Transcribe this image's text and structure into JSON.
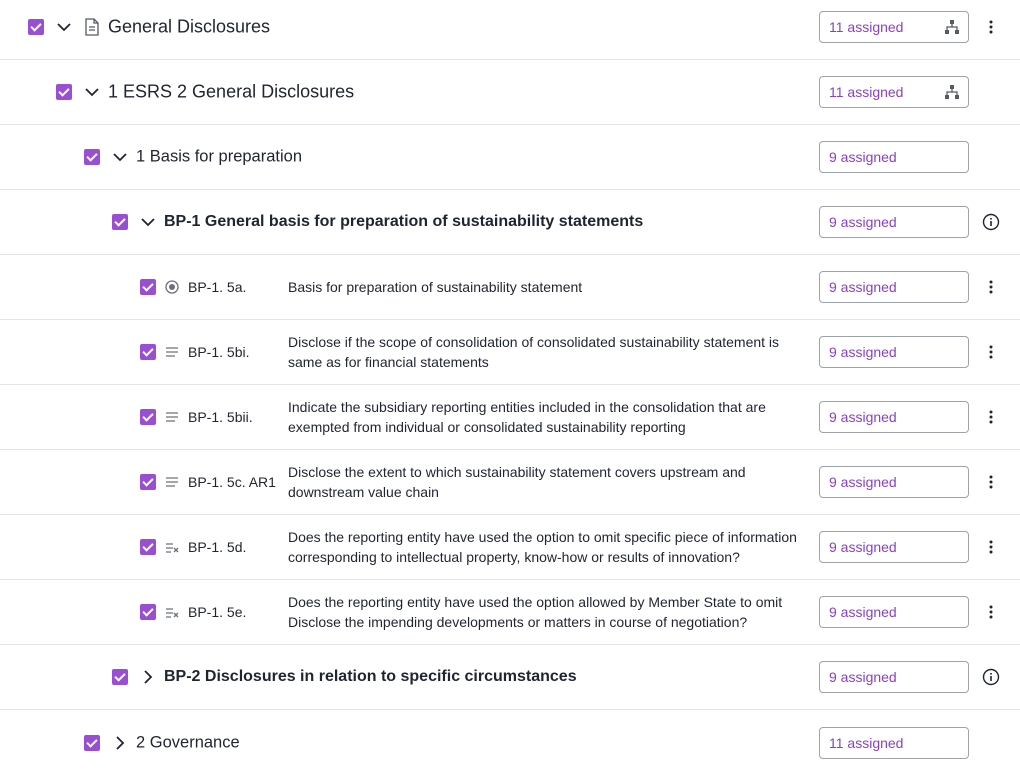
{
  "rows": [
    {
      "title": "General Disclosures",
      "assigned": "11 assigned"
    },
    {
      "title": "1 ESRS 2 General Disclosures",
      "assigned": "11 assigned"
    },
    {
      "title": "1 Basis for preparation",
      "assigned": "9 assigned"
    },
    {
      "title": "BP-1 General basis for preparation of sustainability statements",
      "assigned": "9 assigned"
    },
    {
      "code": "BP-1. 5a.",
      "desc": "Basis for preparation of sustainability statement",
      "assigned": "9 assigned",
      "type_icon": "radio-icon"
    },
    {
      "code": "BP-1. 5bi.",
      "desc": "Disclose if the scope of consolidation of consolidated sustainability statement is same as for financial statements",
      "assigned": "9 assigned",
      "type_icon": "text-lines-icon"
    },
    {
      "code": "BP-1. 5bii.",
      "desc": "Indicate the subsidiary reporting entities included in the consolidation that are exempted from individual or consolidated sustainability reporting",
      "assigned": "9 assigned",
      "type_icon": "text-lines-icon"
    },
    {
      "code": "BP-1. 5c. AR1",
      "desc": "Disclose the extent to which sustainability statement covers upstream and downstream value chain",
      "assigned": "9 assigned",
      "type_icon": "text-lines-icon"
    },
    {
      "code": "BP-1. 5d.",
      "desc": "Does the reporting entity have used the option to omit specific piece of information corresponding to intellectual property, know-how or results of innovation?",
      "assigned": "9 assigned",
      "type_icon": "yes-no-icon"
    },
    {
      "code": "BP-1. 5e.",
      "desc": "Does the reporting entity have used the option allowed by Member State to omit Disclose the impending developments or matters in course of negotiation?",
      "assigned": "9 assigned",
      "type_icon": "yes-no-icon"
    },
    {
      "title": "BP-2 Disclosures in relation to specific circumstances",
      "assigned": "9 assigned"
    },
    {
      "title": "2 Governance",
      "assigned": "11 assigned"
    }
  ],
  "colors": {
    "accent": "#9a4fd3",
    "assigned_text": "#8a3fc9",
    "border": "#e3e4e8"
  }
}
